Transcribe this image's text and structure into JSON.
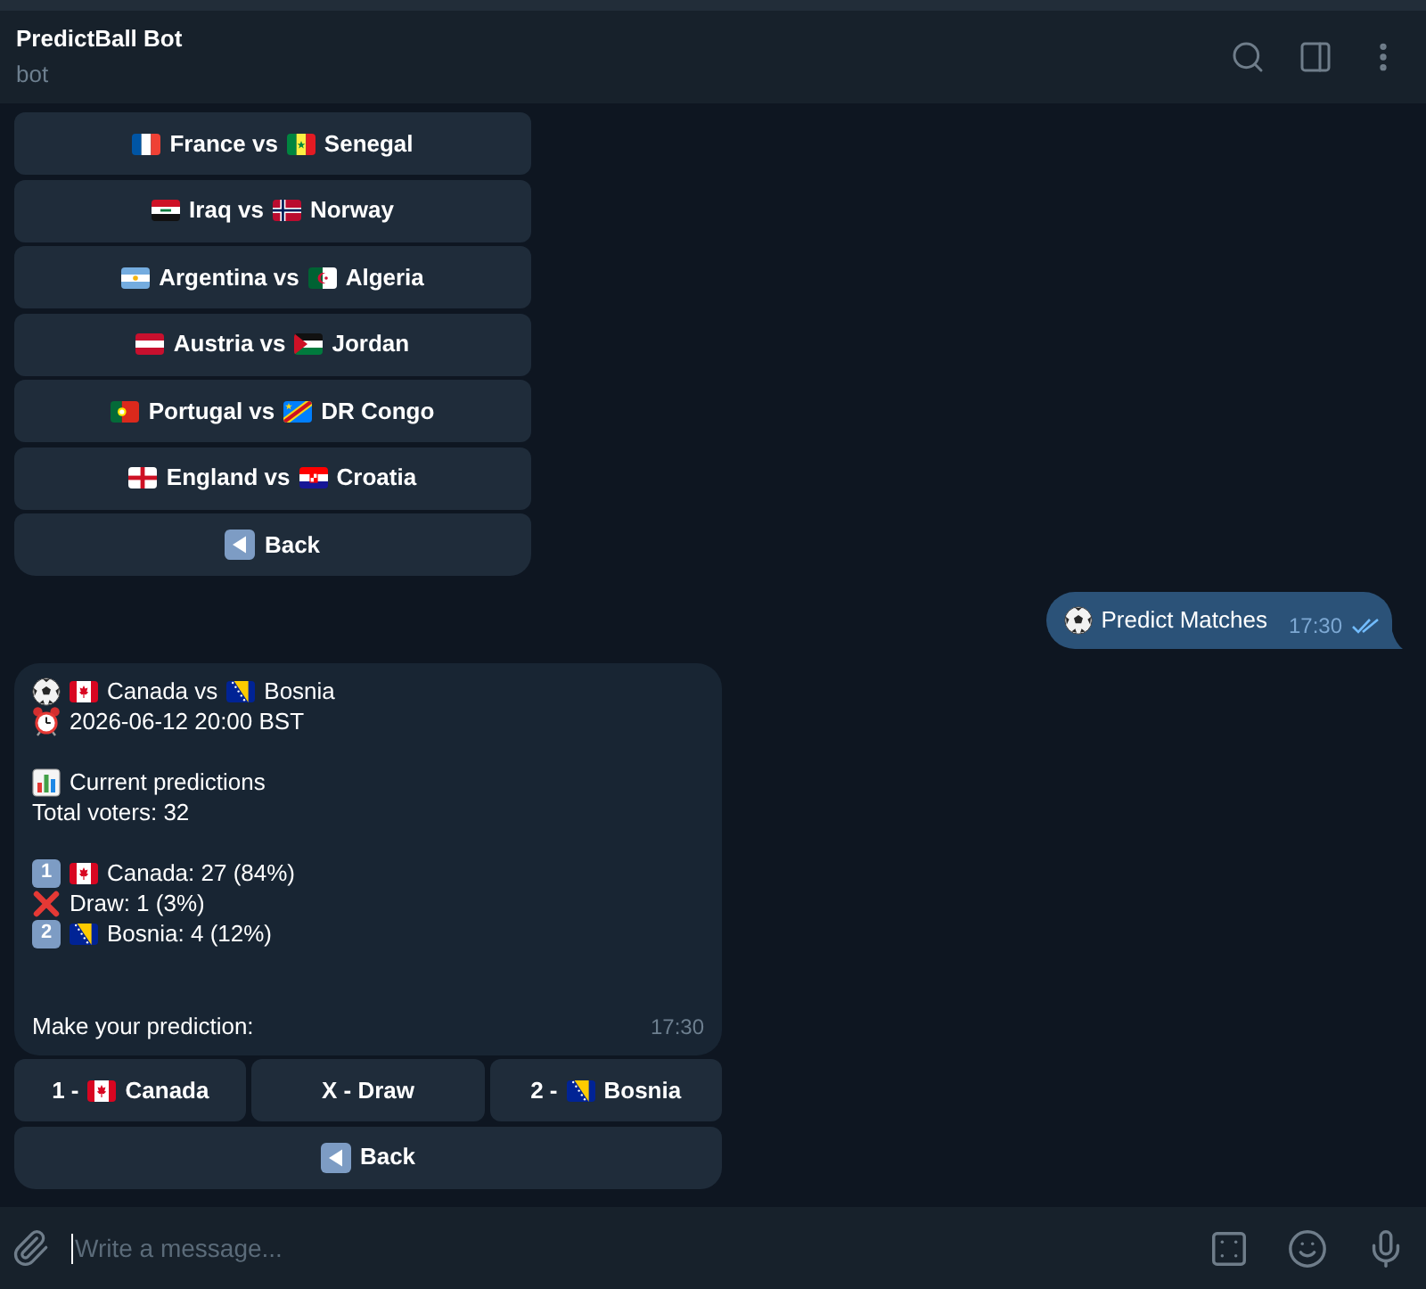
{
  "header": {
    "title": "PredictBall Bot",
    "subtitle": "bot"
  },
  "keyboard_top": {
    "matches": [
      {
        "parts": [
          {
            "kind": "flag_fr"
          },
          {
            "kind": "text",
            "text": "France vs"
          },
          {
            "kind": "flag_sn"
          },
          {
            "kind": "text",
            "text": "Senegal"
          }
        ]
      },
      {
        "parts": [
          {
            "kind": "flag_iq"
          },
          {
            "kind": "text",
            "text": "Iraq vs"
          },
          {
            "kind": "flag_no"
          },
          {
            "kind": "text",
            "text": "Norway"
          }
        ]
      },
      {
        "parts": [
          {
            "kind": "flag_ar"
          },
          {
            "kind": "text",
            "text": "Argentina vs"
          },
          {
            "kind": "flag_dz"
          },
          {
            "kind": "text",
            "text": "Algeria"
          }
        ]
      },
      {
        "parts": [
          {
            "kind": "flag_at"
          },
          {
            "kind": "text",
            "text": "Austria vs"
          },
          {
            "kind": "flag_jo"
          },
          {
            "kind": "text",
            "text": "Jordan"
          }
        ]
      },
      {
        "parts": [
          {
            "kind": "flag_pt"
          },
          {
            "kind": "text",
            "text": "Portugal vs"
          },
          {
            "kind": "flag_cd"
          },
          {
            "kind": "text",
            "text": "DR Congo"
          }
        ]
      },
      {
        "parts": [
          {
            "kind": "flag_eng"
          },
          {
            "kind": "text",
            "text": "England vs"
          },
          {
            "kind": "flag_hr"
          },
          {
            "kind": "text",
            "text": "Croatia"
          }
        ]
      }
    ],
    "back": {
      "parts": [
        {
          "kind": "back"
        },
        {
          "kind": "text",
          "text": "Back"
        }
      ]
    }
  },
  "outgoing": {
    "parts": [
      {
        "kind": "ball"
      },
      {
        "kind": "text",
        "text": "Predict Matches"
      }
    ],
    "time": "17:30",
    "read": true
  },
  "incoming": {
    "paragraphs": [
      {
        "lines": [
          {
            "parts": [
              {
                "kind": "ball"
              },
              {
                "kind": "flag_ca"
              },
              {
                "kind": "text",
                "text": "Canada vs"
              },
              {
                "kind": "flag_ba"
              },
              {
                "kind": "text",
                "text": "Bosnia"
              }
            ]
          },
          {
            "parts": [
              {
                "kind": "clock"
              },
              {
                "kind": "text",
                "text": "2026-06-12 20:00 BST"
              }
            ]
          }
        ]
      },
      {
        "lines": [
          {
            "parts": [
              {
                "kind": "chart"
              },
              {
                "kind": "text",
                "text": "Current predictions"
              }
            ]
          },
          {
            "parts": [
              {
                "kind": "text",
                "text": "Total voters: 32"
              }
            ]
          }
        ]
      },
      {
        "lines": [
          {
            "parts": [
              {
                "kind": "keycap",
                "text": "1"
              },
              {
                "kind": "flag_ca"
              },
              {
                "kind": "text",
                "text": "Canada: 27 (84%)"
              }
            ]
          },
          {
            "parts": [
              {
                "kind": "cross"
              },
              {
                "kind": "text",
                "text": "Draw: 1 (3%)"
              }
            ]
          },
          {
            "parts": [
              {
                "kind": "keycap",
                "text": "2"
              },
              {
                "kind": "flag_ba"
              },
              {
                "kind": "text",
                "text": "Bosnia: 4 (12%)"
              }
            ]
          }
        ]
      }
    ],
    "prompt": "Make your prediction:",
    "time": "17:30",
    "keyboard": {
      "choices": [
        {
          "parts": [
            {
              "kind": "text",
              "text": "1 -"
            },
            {
              "kind": "flag_ca"
            },
            {
              "kind": "text",
              "text": "Canada"
            }
          ]
        },
        {
          "parts": [
            {
              "kind": "text",
              "text": "X - Draw"
            }
          ]
        },
        {
          "parts": [
            {
              "kind": "text",
              "text": "2 -"
            },
            {
              "kind": "flag_ba"
            },
            {
              "kind": "text",
              "text": "Bosnia"
            }
          ]
        }
      ],
      "back": {
        "parts": [
          {
            "kind": "back"
          },
          {
            "kind": "text",
            "text": "Back"
          }
        ]
      }
    }
  },
  "input": {
    "placeholder": "Write a message...",
    "focused": true
  }
}
